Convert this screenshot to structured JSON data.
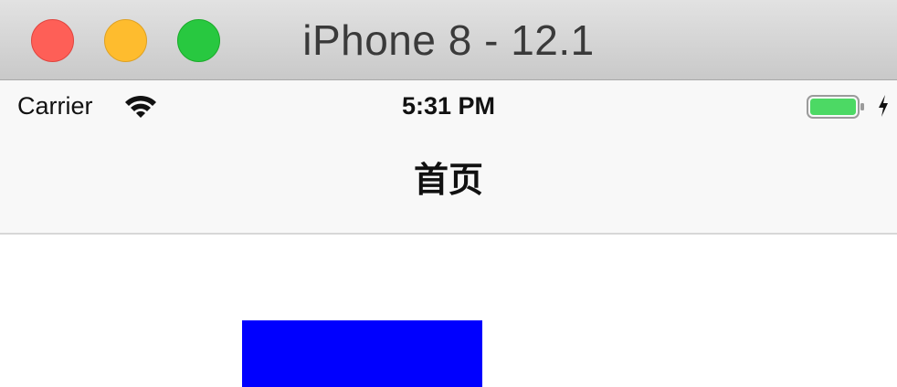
{
  "window": {
    "title": "iPhone 8 - 12.1",
    "controls": {
      "close_color": "#fe5f57",
      "minimize_color": "#febc2e",
      "maximize_color": "#28c840"
    }
  },
  "status_bar": {
    "carrier": "Carrier",
    "wifi_icon": "wifi-icon",
    "time": "5:31 PM",
    "battery_icon": "battery-icon",
    "battery_color": "#4cd964",
    "charging_icon": "charging-bolt-icon"
  },
  "nav_bar": {
    "title": "首页"
  },
  "content": {
    "view_color": "#0000ff"
  }
}
